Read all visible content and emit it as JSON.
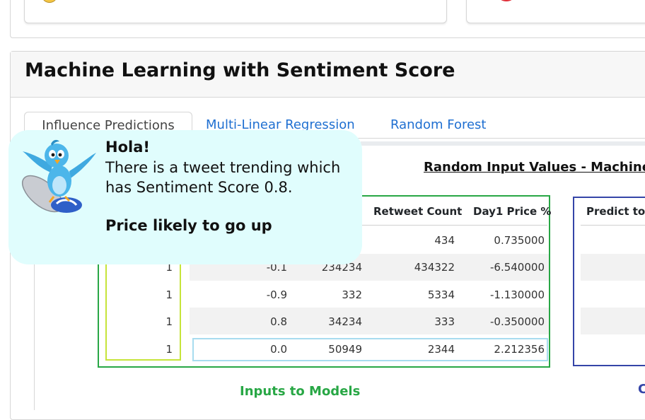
{
  "top_section": {
    "left_card_icon": "coin-icon",
    "right_card_icon": "red-alert-icon"
  },
  "ml_section": {
    "title": "Machine Learning with Sentiment Score",
    "tabs": [
      {
        "label": "Influence Predictions",
        "active": true
      },
      {
        "label": "Multi-Linear Regression",
        "active": false
      },
      {
        "label": "Random Forest",
        "active": false
      }
    ],
    "table_title": "Random Input Values - Machine",
    "columns": {
      "retweet_count": "Retweet Count",
      "day1_price": "Day1 Price %",
      "predict": "Predict to I"
    },
    "rows": [
      {
        "index": "",
        "sentiment": "",
        "followers": "",
        "retweet": "434",
        "price": "0.735000"
      },
      {
        "index": "1",
        "sentiment": "-0.1",
        "followers": "234234",
        "retweet": "434322",
        "price": "-6.540000"
      },
      {
        "index": "1",
        "sentiment": "-0.9",
        "followers": "332",
        "retweet": "5334",
        "price": "-1.130000"
      },
      {
        "index": "1",
        "sentiment": "0.8",
        "followers": "34234",
        "retweet": "333",
        "price": "-0.350000"
      },
      {
        "index": "1",
        "sentiment": "0.0",
        "followers": "50949",
        "retweet": "2344",
        "price": "2.212356"
      }
    ],
    "inputs_label": "Inputs to Models",
    "right_label": "C"
  },
  "notification": {
    "greeting": "Hola!",
    "message": "There is a tweet trending which has Sentiment Score 0.8.",
    "conclusion": "Price likely to go up",
    "mascot_icon": "twitter-bird-surfer-icon"
  },
  "colors": {
    "green": "#28a745",
    "lime": "#c6e43a",
    "blue": "#3545a8",
    "cyan_border": "#a8dcef",
    "bubble_bg": "#e0fdfd",
    "tab_link": "#1f6fd1"
  }
}
